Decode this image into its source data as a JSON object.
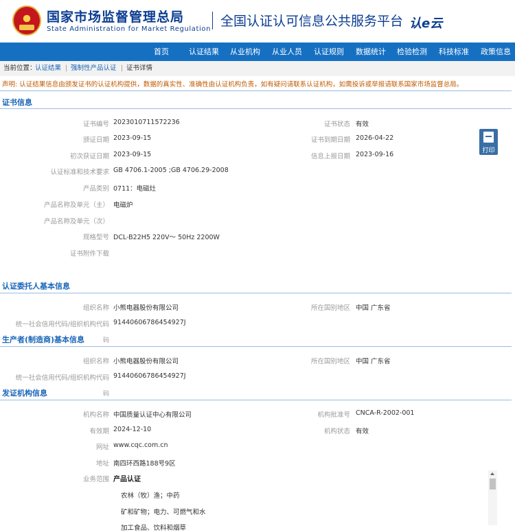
{
  "header": {
    "org_cn": "国家市场监督管理总局",
    "org_en": "State Administration  for  Market Regulation",
    "platform": "全国认证认可信息公共服务平台",
    "logo_text": "认e云"
  },
  "nav": [
    "首页",
    "认证结果",
    "从业机构",
    "从业人员",
    "认证规则",
    "数据统计",
    "检验检测",
    "科技标准",
    "政策信息"
  ],
  "breadcrumb": {
    "prefix": "当前位置：",
    "items": [
      "认证结果",
      "强制性产品认证",
      "证书详情"
    ],
    "sep": "|"
  },
  "notice": "声明: 认证结果信息由颁发证书的认证机构提供，数据的真实性、准确性由认证机构负责，如有疑问请联系认证机构，如需投诉或举报请联系国家市场监督总局。",
  "print_label": "打印",
  "cert": {
    "title": "证书信息",
    "left": [
      {
        "label": "证书编号",
        "value": "2023010711572236"
      },
      {
        "label": "颁证日期",
        "value": "2023-09-15"
      },
      {
        "label": "初次获证日期",
        "value": "2023-09-15"
      },
      {
        "label": "认证标准和技术要求",
        "value": "GB 4706.1-2005 ;GB 4706.29-2008"
      },
      {
        "label": "产品类别",
        "value": "0711：电磁灶"
      },
      {
        "label": "产品名称及单元（主）",
        "value": "电磁炉"
      },
      {
        "label": "产品名称及单元（次）",
        "value": ""
      },
      {
        "label": "规格型号",
        "value": "DCL-B22H5 220V～ 50Hz 2200W"
      },
      {
        "label": "证书附件下载",
        "value": ""
      }
    ],
    "right": [
      {
        "label": "证书状态",
        "value": "有效"
      },
      {
        "label": "证书到期日期",
        "value": "2026-04-22"
      },
      {
        "label": "信息上报日期",
        "value": "2023-09-16"
      }
    ]
  },
  "client": {
    "title": "认证委托人基本信息",
    "name_label": "组织名称",
    "name": "小熊电器股份有限公司",
    "region_label": "所在国别地区",
    "region": "中国 广东省",
    "code_label": "统一社会信用代码/组织机构代码",
    "code": "91440606786454927J"
  },
  "maker": {
    "title": "生产者(制造商)基本信息",
    "trail": "码",
    "name_label": "组织名称",
    "name": "小熊电器股份有限公司",
    "region_label": "所在国别地区",
    "region": "中国 广东省",
    "code_label": "统一社会信用代码/组织机构代码",
    "code": "91440606786454927J"
  },
  "issuer": {
    "title": "发证机构信息",
    "trail": "码",
    "left": [
      {
        "label": "机构名称",
        "value": "中国质量认证中心有限公司"
      },
      {
        "label": "有效期",
        "value": "2024-12-10"
      },
      {
        "label": "网址",
        "value": "www.cqc.com.cn"
      },
      {
        "label": "地址",
        "value": "南四环西路188号9区"
      },
      {
        "label": "业务范围",
        "value": ""
      }
    ],
    "right": [
      {
        "label": "机构批准号",
        "value": "CNCA-R-2002-001"
      },
      {
        "label": "机构状态",
        "value": "有效"
      }
    ],
    "scope_head": "产品认证",
    "scope_items": [
      "农林（牧）渔；中药",
      "矿和矿物；电力、可燃气和水",
      "加工食品、饮料和烟草"
    ]
  }
}
